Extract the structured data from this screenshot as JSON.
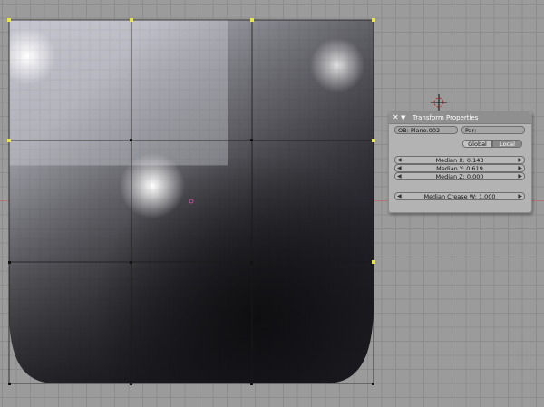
{
  "panel": {
    "title": "Transform Properties",
    "close_icon": "x-icon",
    "collapse_icon": "triangle-down-icon",
    "object_name": "OB: Plane.002",
    "parent_field": "Par:",
    "toggles": [
      "Global",
      "Local"
    ],
    "active_toggle": "Local",
    "median_x": "Median X: 0.143",
    "median_y": "Median Y: 0.619",
    "median_z": "Median Z: 0.000",
    "median_crease": "Median Crease W: 1.000"
  },
  "colors": {
    "background": "#9b9b9b",
    "grid": "#8d8d8d",
    "x_axis": "#b27474",
    "selected_vertex": "#e8e84a",
    "unselected_vertex": "#111111",
    "mesh_face_center": "#c050a0"
  }
}
